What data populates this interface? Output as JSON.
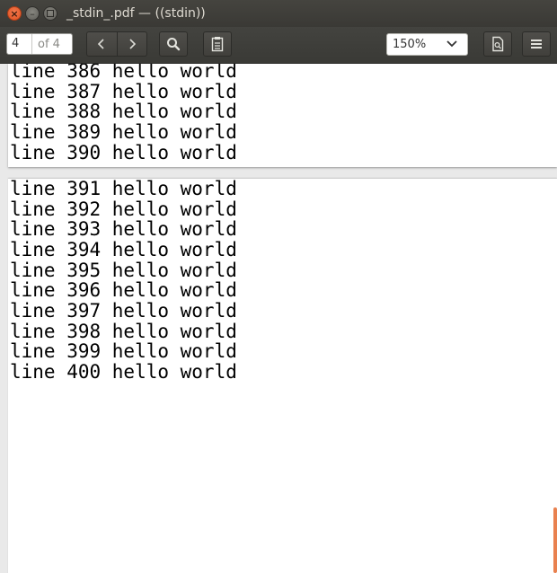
{
  "window": {
    "title": "_stdin_.pdf — ((stdin))"
  },
  "toolbar": {
    "page_current": "4",
    "page_total": "of 4",
    "zoom": "150%"
  },
  "icons": {
    "close": "close-icon",
    "minimize": "minimize-icon",
    "maximize": "maximize-icon",
    "prev": "chevron-left-icon",
    "next": "chevron-right-icon",
    "search": "search-icon",
    "annotations": "clipboard-icon",
    "pages": "document-icon",
    "menu": "hamburger-menu-icon",
    "dropdown": "chevron-down-icon"
  },
  "document": {
    "page_top_lines": [
      "line 386 hello world",
      "line 387 hello world",
      "line 388 hello world",
      "line 389 hello world",
      "line 390 hello world"
    ],
    "page_bottom_lines": [
      "line 391 hello world",
      "line 392 hello world",
      "line 393 hello world",
      "line 394 hello world",
      "line 395 hello world",
      "line 396 hello world",
      "line 397 hello world",
      "line 398 hello world",
      "line 399 hello world",
      "line 400 hello world"
    ]
  },
  "colors": {
    "close_button": "#e0501f",
    "scroll_indicator": "#e9814f",
    "titlebar": "#3c3b37"
  }
}
